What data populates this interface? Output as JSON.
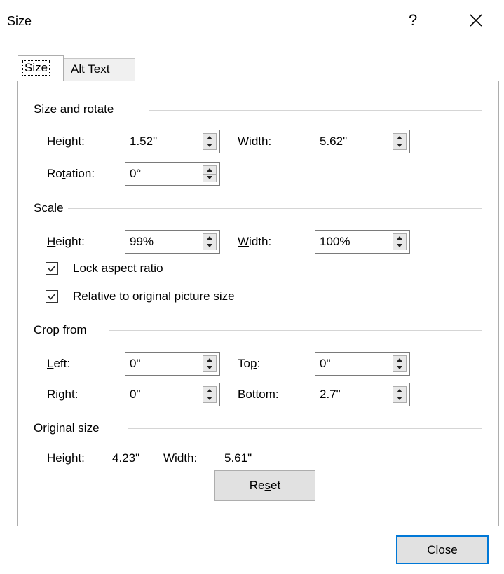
{
  "window": {
    "title": "Size",
    "help_label": "?",
    "close_icon": "close-icon"
  },
  "tabs": [
    {
      "label": "Size",
      "active": true
    },
    {
      "label": "Alt Text",
      "active": false
    }
  ],
  "size_and_rotate": {
    "header": "Size and rotate",
    "height": {
      "label_pre": "He",
      "label_u": "i",
      "label_post": "ght:",
      "value": "1.52\""
    },
    "width": {
      "label_pre": "Wi",
      "label_u": "d",
      "label_post": "th:",
      "value": "5.62\""
    },
    "rotation": {
      "label_pre": "Ro",
      "label_u": "t",
      "label_post": "ation:",
      "value": "0°"
    }
  },
  "scale": {
    "header": "Scale",
    "height": {
      "label_u": "H",
      "label_post": "eight:",
      "value": "99%"
    },
    "width": {
      "label_u": "W",
      "label_post": "idth:",
      "value": "100%"
    },
    "lock_aspect": {
      "label_pre": "Lock ",
      "label_u": "a",
      "label_post": "spect ratio",
      "checked": true
    },
    "relative": {
      "label_u": "R",
      "label_post": "elative to original picture size",
      "checked": true
    }
  },
  "crop": {
    "header": "Crop from",
    "left": {
      "label_u": "L",
      "label_post": "eft:",
      "value": "0\""
    },
    "top": {
      "label_pre": "To",
      "label_u": "p",
      "label_post": ":",
      "value": "0\""
    },
    "right": {
      "label_pre": "Ri",
      "label_u": "g",
      "label_post": "ht:",
      "value": "0\""
    },
    "bottom": {
      "label_pre": "Botto",
      "label_u": "m",
      "label_post": ":",
      "value": "2.7\""
    }
  },
  "original_size": {
    "header": "Original size",
    "height_label": "Height:",
    "height_value": "4.23\"",
    "width_label": "Width:",
    "width_value": "5.61\""
  },
  "buttons": {
    "reset_pre": "Re",
    "reset_u": "s",
    "reset_post": "et",
    "close": "Close"
  }
}
